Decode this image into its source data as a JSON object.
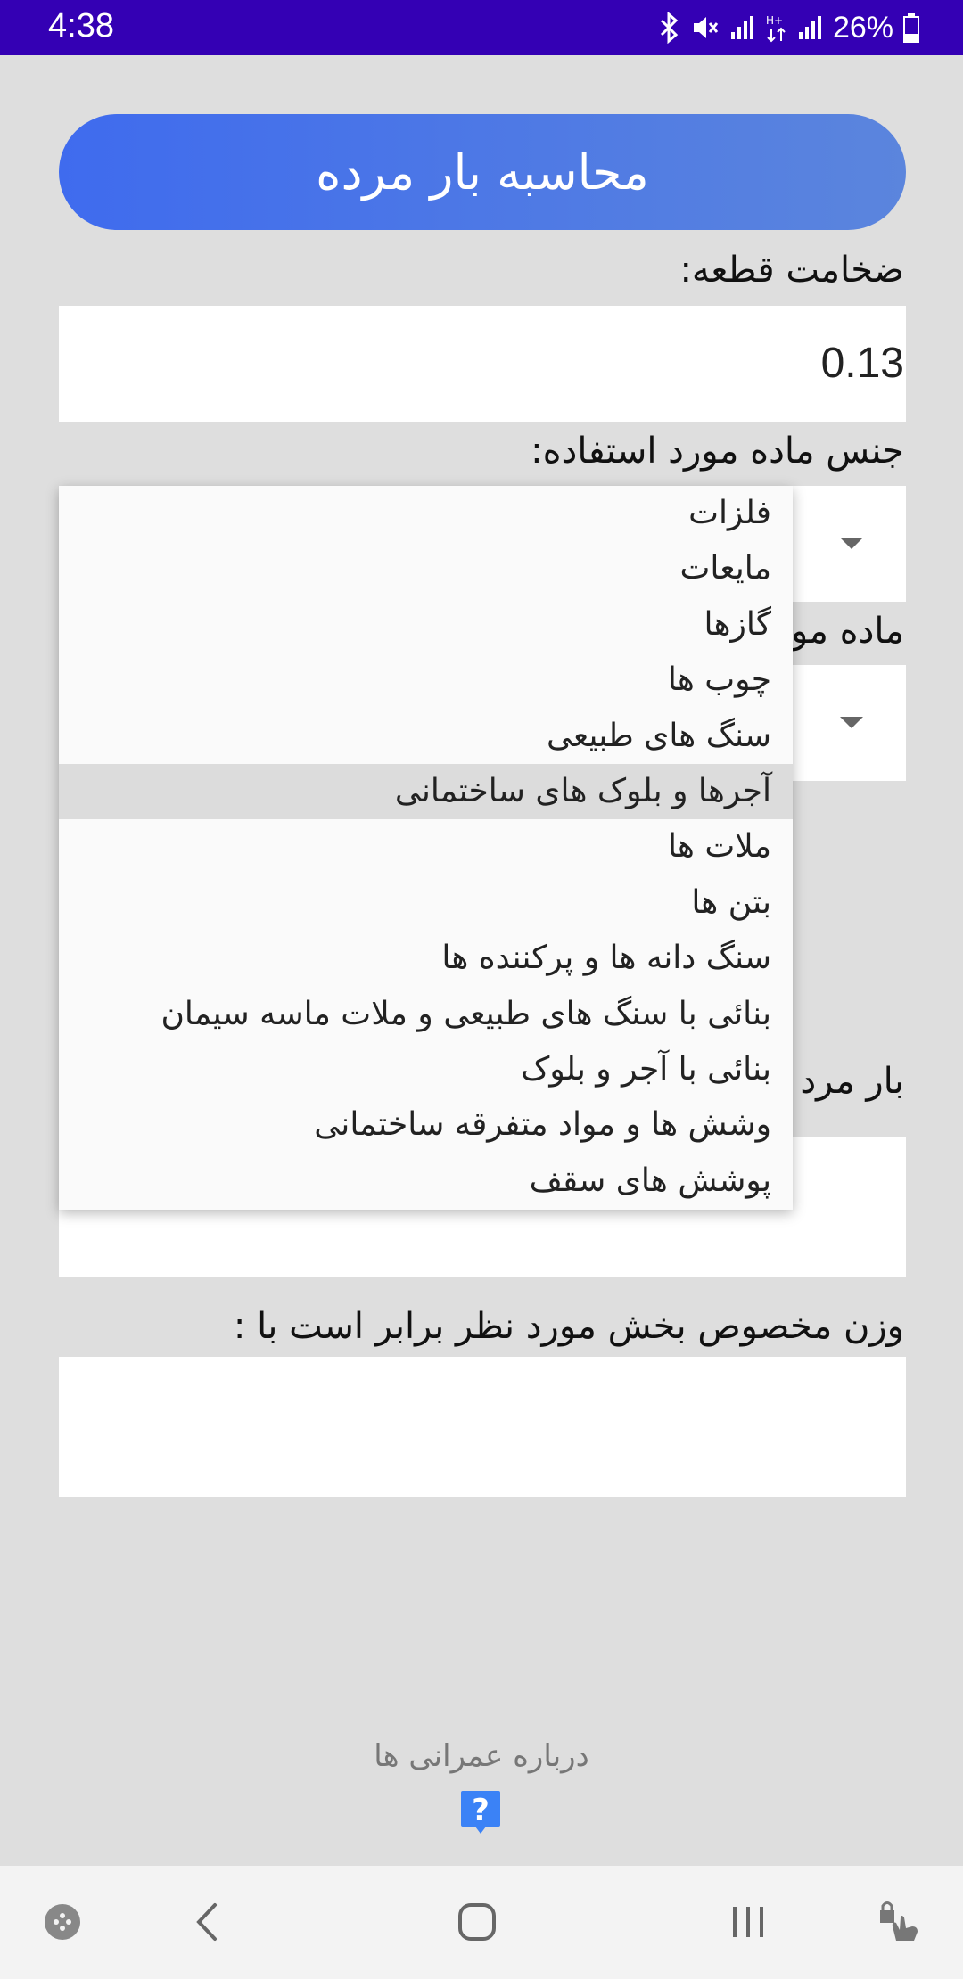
{
  "status_bar": {
    "time": "4:38",
    "battery": "26%",
    "icons": [
      "bluetooth-icon",
      "mute-icon",
      "signal-icon",
      "data-icon",
      "signal-icon",
      "battery-icon"
    ]
  },
  "header": {
    "title": "محاسبه بار مرده"
  },
  "form": {
    "thickness_label": "ضخامت قطعه:",
    "thickness_value": "0.13",
    "material_type_label": "جنس ماده مورد استفاده:",
    "material_label_partial": "ماده مو",
    "dead_load_label_partial": "بار مرد",
    "specific_weight_label": "وزن مخصوص بخش مورد نظر برابر است با :",
    "specific_weight_value": ""
  },
  "dropdown": {
    "selected_index": 5,
    "items": [
      "فلزات",
      "مایعات",
      "گازها",
      "چوب ها",
      "سنگ های طبیعی",
      "آجرها و بلوک های ساختمانی",
      "ملات ها",
      "بتن ها",
      "سنگ دانه ها و پرکننده ها",
      "بنائی با سنگ های طبیعی و ملات ماسه سیمان",
      "بنائی با آجر و بلوک",
      "وشش ها و مواد متفرقه ساختمانی",
      "پوشش های سقف"
    ]
  },
  "footer": {
    "about_label": "درباره عمرانی ها",
    "help_icon": "question-icon"
  },
  "nav_bar": {
    "buttons": [
      "game-launcher-icon",
      "back-icon",
      "home-icon",
      "recents-icon",
      "touch-lock-icon"
    ]
  },
  "colors": {
    "status_bar": "#3400b4",
    "title_gradient_start": "#3f6bee",
    "title_gradient_end": "#5b85dd",
    "background": "#dedede",
    "help_icon": "#3b82f6"
  }
}
